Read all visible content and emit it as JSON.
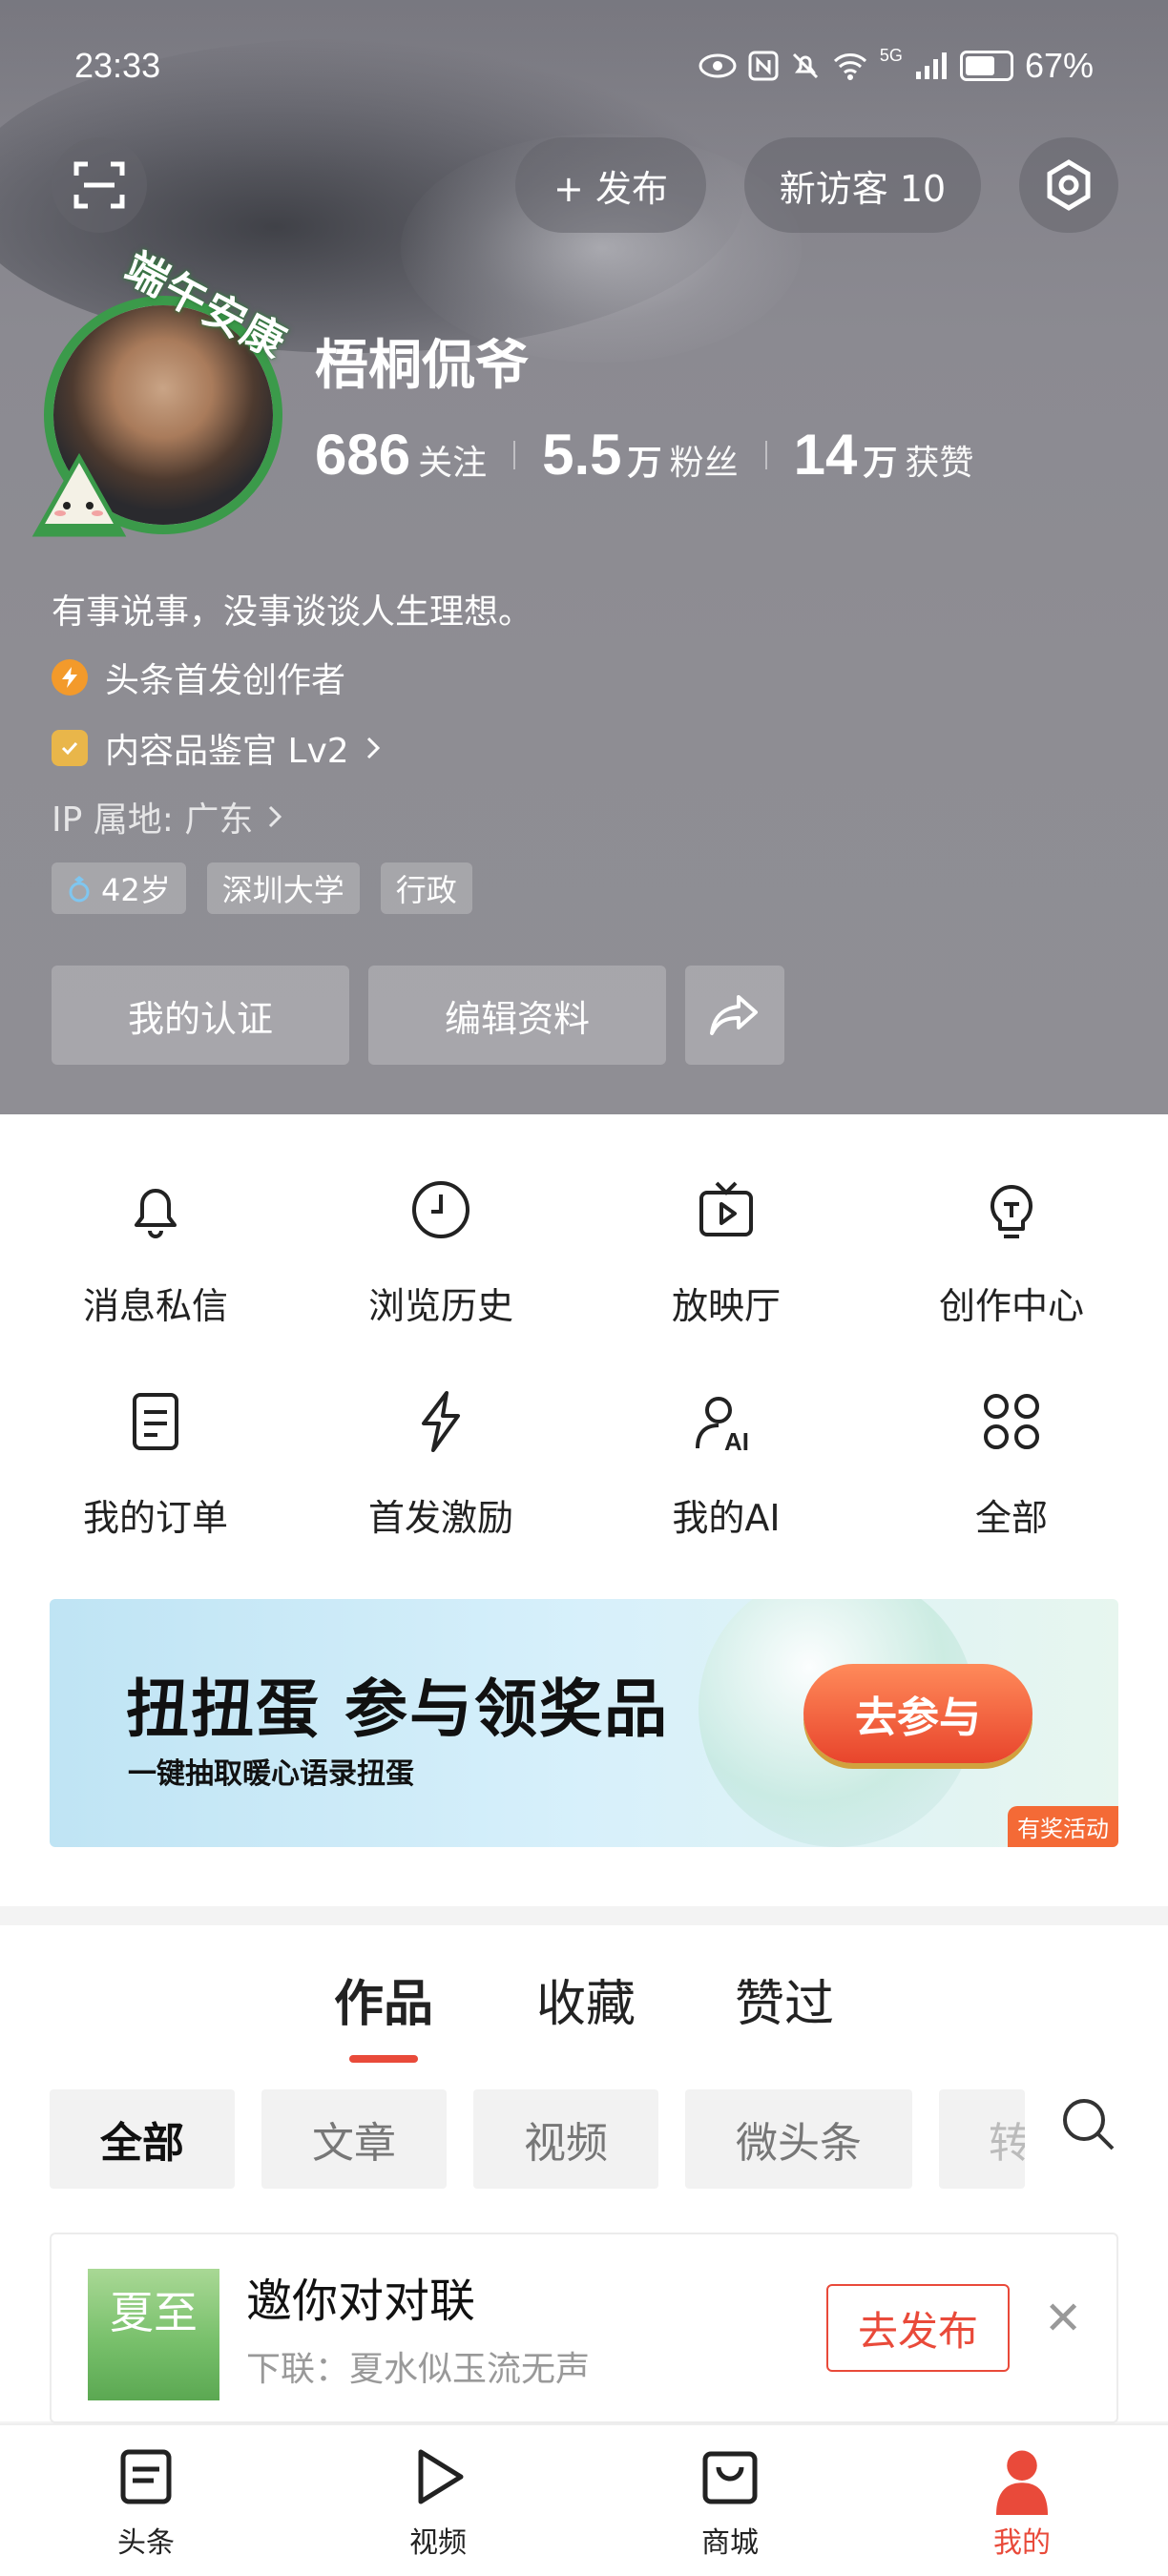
{
  "status_bar": {
    "time": "23:33",
    "battery": "67%",
    "network": "5G"
  },
  "header": {
    "publish_label": "+ 发布",
    "visitor_label": "新访客 10"
  },
  "profile": {
    "avatar_badge": "端午安康",
    "name": "梧桐侃爷",
    "stats": [
      {
        "num": "686",
        "unit": "",
        "label": "关注"
      },
      {
        "num": "5.5",
        "unit": "万",
        "label": "粉丝"
      },
      {
        "num": "14",
        "unit": "万",
        "label": "获赞"
      }
    ],
    "bio": "有事说事，没事谈谈人生理想。",
    "badge1": "头条首发创作者",
    "badge2": "内容品鉴官 Lv2",
    "ip": "IP 属地: 广东",
    "tags": [
      "42岁",
      "深圳大学",
      "行政"
    ],
    "actions": {
      "verify": "我的认证",
      "edit": "编辑资料"
    }
  },
  "menu": [
    {
      "label": "消息私信",
      "icon": "bell-icon"
    },
    {
      "label": "浏览历史",
      "icon": "clock-icon"
    },
    {
      "label": "放映厅",
      "icon": "tv-icon"
    },
    {
      "label": "创作中心",
      "icon": "bulb-icon"
    },
    {
      "label": "我的订单",
      "icon": "order-icon"
    },
    {
      "label": "首发激励",
      "icon": "bolt-icon"
    },
    {
      "label": "我的AI",
      "icon": "ai-user-icon"
    },
    {
      "label": "全部",
      "icon": "grid-icon"
    }
  ],
  "banner": {
    "title": "扭扭蛋 参与领奖品",
    "subtitle": "一键抽取暖心语录扭蛋",
    "button": "去参与",
    "corner": "有奖活动"
  },
  "tabs": [
    "作品",
    "收藏",
    "赞过"
  ],
  "chips": [
    "全部",
    "文章",
    "视频",
    "微头条",
    "转"
  ],
  "card": {
    "thumb_text": "夏至",
    "title": "邀你对对联",
    "subtitle": "下联：夏水似玉流无声",
    "button": "去发布"
  },
  "bottom_nav": [
    "头条",
    "视频",
    "商城",
    "我的"
  ],
  "colors": {
    "accent": "#e94a3a",
    "badge_green": "#3b9a4a"
  }
}
